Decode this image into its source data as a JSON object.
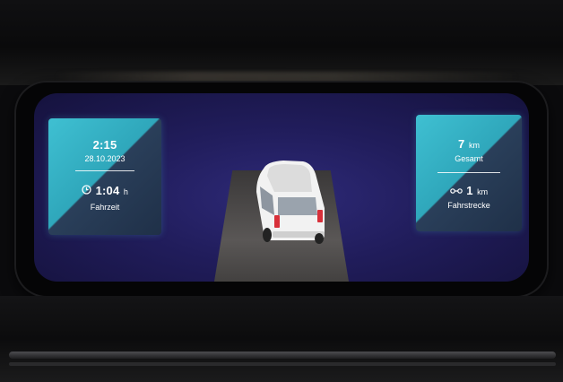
{
  "left_panel": {
    "time": "2:15",
    "date": "28.10.2023",
    "duration_value": "1:04",
    "duration_unit": "h",
    "duration_label": "Fahrzeit",
    "icon": "clock-icon"
  },
  "right_panel": {
    "total_value": "7",
    "total_unit": "km",
    "total_label": "Gesamt",
    "trip_value": "1",
    "trip_unit": "km",
    "trip_label": "Fahrstrecke",
    "icon": "route-icon"
  },
  "vehicle": {
    "icon": "van-icon",
    "color": "#f2f2f2",
    "taillight_color": "#d8303a"
  },
  "colors": {
    "display_bg": "#211d5c",
    "panel_accent": "#3fc0d2"
  }
}
